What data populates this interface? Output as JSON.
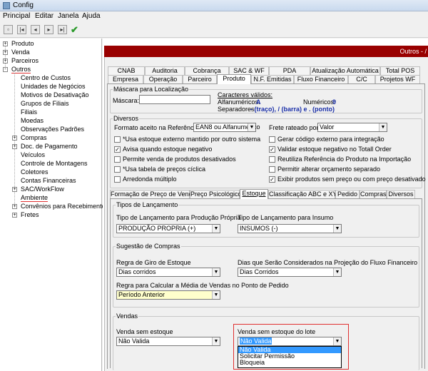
{
  "window": {
    "title": "Config"
  },
  "menu": [
    "Principal",
    "Editar",
    "Janela",
    "Ajuda"
  ],
  "tree": {
    "top": [
      {
        "label": "Produto",
        "exp": "+"
      },
      {
        "label": "Venda",
        "exp": "+"
      },
      {
        "label": "Parceiros",
        "exp": "+"
      },
      {
        "label": "Outros",
        "exp": "-"
      }
    ],
    "children": [
      {
        "label": "Centro de Custos"
      },
      {
        "label": "Unidades de Negócios"
      },
      {
        "label": "Motivos de Desativação"
      },
      {
        "label": "Grupos de Filiais"
      },
      {
        "label": "Filiais"
      },
      {
        "label": "Moedas"
      },
      {
        "label": "Observações Padrões"
      },
      {
        "label": "Compras",
        "exp": "+"
      },
      {
        "label": "Doc. de Pagamento",
        "exp": "+"
      },
      {
        "label": "Veículos"
      },
      {
        "label": "Controle de Montagens"
      },
      {
        "label": "Coletores"
      },
      {
        "label": "Contas Financeiras"
      },
      {
        "label": "SAC/WorkFlow",
        "exp": "+"
      },
      {
        "label": "Ambiente"
      },
      {
        "label": "Convênios para Recebimentos c",
        "exp": "+"
      },
      {
        "label": "Fretes",
        "exp": "+"
      }
    ]
  },
  "header": {
    "right_text": "Outros - /"
  },
  "tabs_row1": [
    "CNAB",
    "Auditoria",
    "Cobrança",
    "SAC & WF",
    "PDA",
    "Atualização Automática",
    "Total POS"
  ],
  "tabs_row2": [
    "Empresa",
    "Operação",
    "Parceiro",
    "Produto",
    "N.F. Emitidas",
    "Fluxo Financeiro",
    "C/C",
    "Projetos WF"
  ],
  "mascara": {
    "title": "Máscara para Localização",
    "label": "Máscara:",
    "valid_title": "Caracteres válidos:",
    "alfa_label": "Alfanuméricos:",
    "alfa_value": "A",
    "num_label": "Numéricos:",
    "num_value": "9",
    "sep_label": "Separadores:",
    "sep_value": "- (traço), / (barra) e . (ponto)"
  },
  "diversos": {
    "title": "Diversos",
    "formato_label": "Formato aceito na Referência",
    "formato_value": "EAN8 ou Alfanumérico",
    "frete_label": "Frete rateado por:",
    "frete_value": "Valor",
    "checks_left": [
      {
        "label": "*Usa estoque externo mantido por outro sistema",
        "checked": false
      },
      {
        "label": "Avisa quando estoque negativo",
        "checked": true
      },
      {
        "label": "Permite venda de produtos desativados",
        "checked": false
      },
      {
        "label": "*Usa tabela de preços cíclica",
        "checked": false
      },
      {
        "label": "Arredonda múltiplo",
        "checked": false
      }
    ],
    "checks_right": [
      {
        "label": "Gerar código externo para integração",
        "checked": false
      },
      {
        "label": "Validar estoque negativo no Totall Order",
        "checked": true
      },
      {
        "label": "Reutiliza Referência do Produto na Importação",
        "checked": false
      },
      {
        "label": "Permitir alterar orçamento separado",
        "checked": false
      },
      {
        "label": "Exibir produtos sem preço ou com preço desativado",
        "checked": true
      }
    ]
  },
  "subtabs": [
    "Formação de Preço de Venda",
    "Preço Psicológico",
    "Estoque",
    "Classificação ABC e XYZ",
    "Pedido",
    "Compras",
    "Diversos"
  ],
  "tipos": {
    "title": "Tipos de Lançamento",
    "prod_label": "Tipo de Lançamento para Produção Própria",
    "prod_value": "PRODUÇÃO PROPRIA (+)",
    "insumo_label": "Tipo de Lançamento para Insumo",
    "insumo_value": "INSUMOS (-)"
  },
  "sugestao": {
    "title": "Sugestão de Compras",
    "giro_label": "Regra de Giro de Estoque",
    "giro_value": "Dias corridos",
    "dias_label": "Dias que Serão Considerados na Projeção do Fluxo Financeiro",
    "dias_value": "Dias Corridos",
    "media_label": "Regra para Calcular a Média de Vendas no Ponto de Pedido",
    "media_value": "Período Anterior"
  },
  "vendas": {
    "title": "Vendas",
    "sem_estoque_label": "Venda sem estoque",
    "sem_estoque_value": "Não Valida",
    "lote_label": "Venda sem estoque do lote",
    "lote_value": "Não Valida",
    "lote_options": [
      "Não Valida",
      "Solicitar Permissão",
      "Bloqueia"
    ]
  }
}
